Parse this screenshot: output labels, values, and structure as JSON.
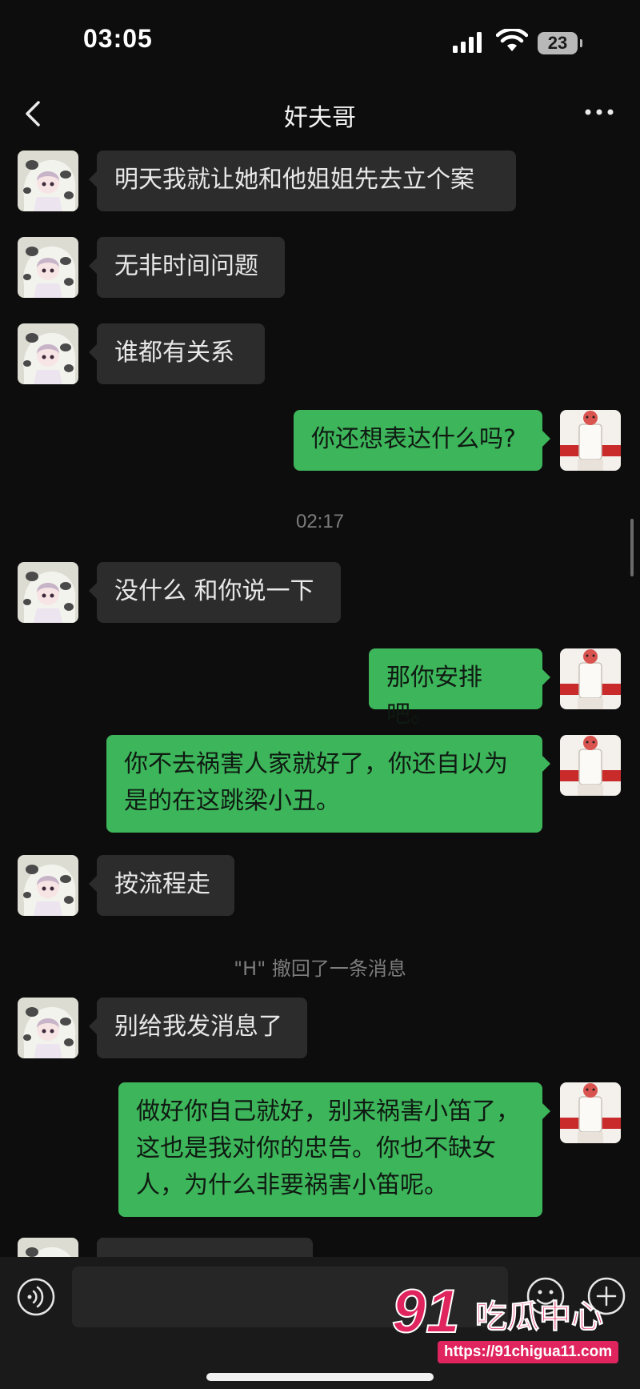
{
  "status_bar": {
    "time": "03:05",
    "battery": "23"
  },
  "header": {
    "title": "奸夫哥"
  },
  "messages": [
    {
      "side": "in",
      "text": "明天我就让她和他姐姐先去立个案"
    },
    {
      "side": "in",
      "text": "无非时间问题"
    },
    {
      "side": "in",
      "text": "谁都有关系"
    },
    {
      "side": "out",
      "text": "你还想表达什么吗?"
    },
    {
      "type": "timestamp",
      "text": "02:17"
    },
    {
      "side": "in",
      "text": "没什么 和你说一下"
    },
    {
      "side": "out",
      "text": "那你安排吧。"
    },
    {
      "side": "out",
      "text": "你不去祸害人家就好了，你还自以为\n是的在这跳梁小丑。"
    },
    {
      "side": "in",
      "text": "按流程走"
    },
    {
      "type": "system",
      "text": "\"H\" 撤回了一条消息"
    },
    {
      "side": "in",
      "text": "别给我发消息了"
    },
    {
      "side": "out",
      "text": "做好你自己就好，别来祸害小笛了，\n这也是我对你的忠告。你也不缺女\n人，为什么非要祸害小笛呢。"
    }
  ],
  "avatars": {
    "contact": "cartoon-girl-cow-avatar",
    "self": "fa-mahjong-tile-avatar",
    "self_glyph": "發"
  },
  "input_bar": {
    "placeholder": ""
  },
  "watermark": {
    "logo_number": "91",
    "logo_text": "吃瓜中心",
    "url": "https://91chigua11.com"
  },
  "colors": {
    "background": "#0d0d0d",
    "incoming_bubble": "#2c2c2c",
    "outgoing_bubble": "#3db55a",
    "watermark": "#e0245e"
  }
}
